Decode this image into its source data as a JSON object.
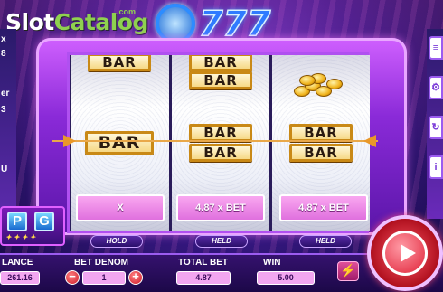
{
  "watermark": {
    "part1": "Slot",
    "part2": "Catalog",
    "suffix": ".com"
  },
  "logo": {
    "text": "777"
  },
  "side_left": {
    "cut_labels": [
      "x",
      "8",
      "er",
      "3",
      "U"
    ]
  },
  "reels": [
    {
      "symbols": [
        "BAR",
        "BAR"
      ]
    },
    {
      "symbols": [
        "BAR",
        "BAR",
        "BAR",
        "BAR"
      ]
    },
    {
      "symbols": [
        "BAR",
        "BAR"
      ]
    }
  ],
  "win_plates": [
    "X",
    "4.87 x BET",
    "4.87 x BET"
  ],
  "hold_buttons": [
    "HOLD",
    "HELD",
    "HELD"
  ],
  "pg_badge": {
    "tile1": "P",
    "tile2": "G"
  },
  "bottom": {
    "balance_label": "LANCE",
    "balance_value": "261.16",
    "bet_denom_label": "BET DENOM",
    "bet_denom_value": "1",
    "minus": "−",
    "plus": "+",
    "total_bet_label": "TOTAL BET",
    "total_bet_value": "4.87",
    "win_label": "WIN",
    "win_value": "5.00",
    "turbo_icon": "⚡"
  }
}
